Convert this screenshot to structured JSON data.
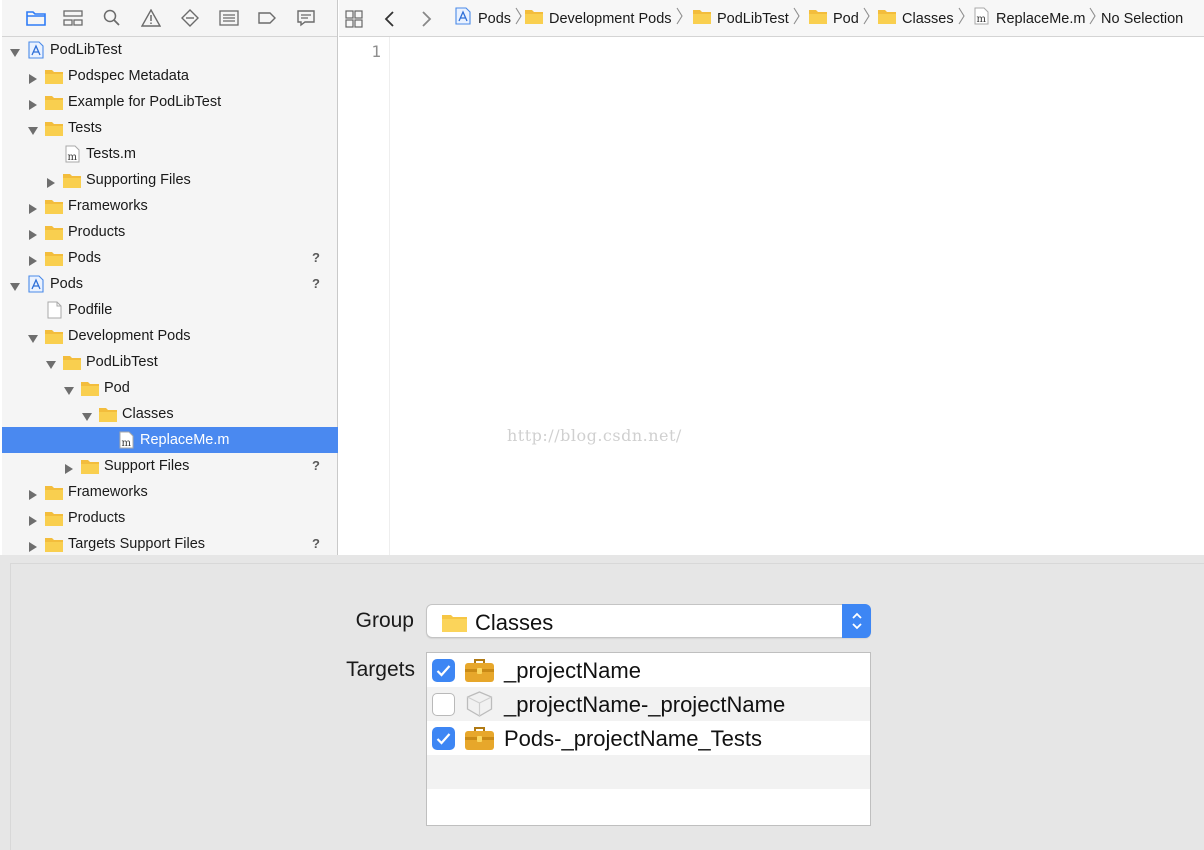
{
  "navigator": {
    "toolbar_icons": [
      "folder-icon",
      "hierarchy-icon",
      "search-icon",
      "warning-icon",
      "diamond-icon",
      "list-icon",
      "tag-icon",
      "comment-icon"
    ],
    "rows": [
      {
        "label": "PodLibTest",
        "icon": "project-icon",
        "expanded": true,
        "badge": ""
      },
      {
        "label": "Podspec Metadata",
        "icon": "folder-icon",
        "expanded": false,
        "badge": ""
      },
      {
        "label": "Example for PodLibTest",
        "icon": "folder-icon",
        "expanded": false,
        "badge": ""
      },
      {
        "label": "Tests",
        "icon": "folder-icon",
        "expanded": true,
        "badge": ""
      },
      {
        "label": "Tests.m",
        "icon": "m-file-icon",
        "expanded": null,
        "badge": ""
      },
      {
        "label": "Supporting Files",
        "icon": "folder-icon",
        "expanded": false,
        "badge": ""
      },
      {
        "label": "Frameworks",
        "icon": "folder-icon",
        "expanded": false,
        "badge": ""
      },
      {
        "label": "Products",
        "icon": "folder-icon",
        "expanded": false,
        "badge": ""
      },
      {
        "label": "Pods",
        "icon": "folder-icon",
        "expanded": false,
        "badge": "?"
      },
      {
        "label": "Pods",
        "icon": "project-icon",
        "expanded": true,
        "badge": "?"
      },
      {
        "label": "Podfile",
        "icon": "file-icon",
        "expanded": null,
        "badge": ""
      },
      {
        "label": "Development Pods",
        "icon": "folder-icon",
        "expanded": true,
        "badge": ""
      },
      {
        "label": "PodLibTest",
        "icon": "folder-icon",
        "expanded": true,
        "badge": ""
      },
      {
        "label": "Pod",
        "icon": "folder-icon",
        "expanded": true,
        "badge": ""
      },
      {
        "label": "Classes",
        "icon": "folder-icon",
        "expanded": true,
        "badge": ""
      },
      {
        "label": "ReplaceMe.m",
        "icon": "m-file-icon",
        "expanded": null,
        "badge": "",
        "selected": true
      },
      {
        "label": "Support Files",
        "icon": "folder-icon",
        "expanded": false,
        "badge": "?"
      },
      {
        "label": "Frameworks",
        "icon": "folder-icon",
        "expanded": false,
        "badge": ""
      },
      {
        "label": "Products",
        "icon": "folder-icon",
        "expanded": false,
        "badge": ""
      },
      {
        "label": "Targets Support Files",
        "icon": "folder-icon",
        "expanded": false,
        "badge": "?"
      }
    ]
  },
  "jump_bar": {
    "items": [
      {
        "label": "Pods",
        "icon": "project-icon"
      },
      {
        "label": "Development Pods",
        "icon": "folder-icon"
      },
      {
        "label": "PodLibTest",
        "icon": "folder-icon"
      },
      {
        "label": "Pod",
        "icon": "folder-icon"
      },
      {
        "label": "Classes",
        "icon": "folder-icon"
      },
      {
        "label": "ReplaceMe.m",
        "icon": "m-file-icon"
      },
      {
        "label": "No Selection",
        "icon": ""
      }
    ]
  },
  "editor": {
    "line_number": "1",
    "watermark": "http://blog.csdn.net/"
  },
  "sheet": {
    "group_label": "Group",
    "group_value": "Classes",
    "targets_label": "Targets",
    "targets": [
      {
        "name": "_projectName",
        "checked": true,
        "icon": "toolbox-icon"
      },
      {
        "name": "_projectName-_projectName",
        "checked": false,
        "icon": "bundle-icon"
      },
      {
        "name": "Pods-_projectName_Tests",
        "checked": true,
        "icon": "toolbox-icon"
      }
    ]
  },
  "colors": {
    "selection": "#4a89f0",
    "accent": "#3d86f4",
    "folder": "#f6c644"
  }
}
